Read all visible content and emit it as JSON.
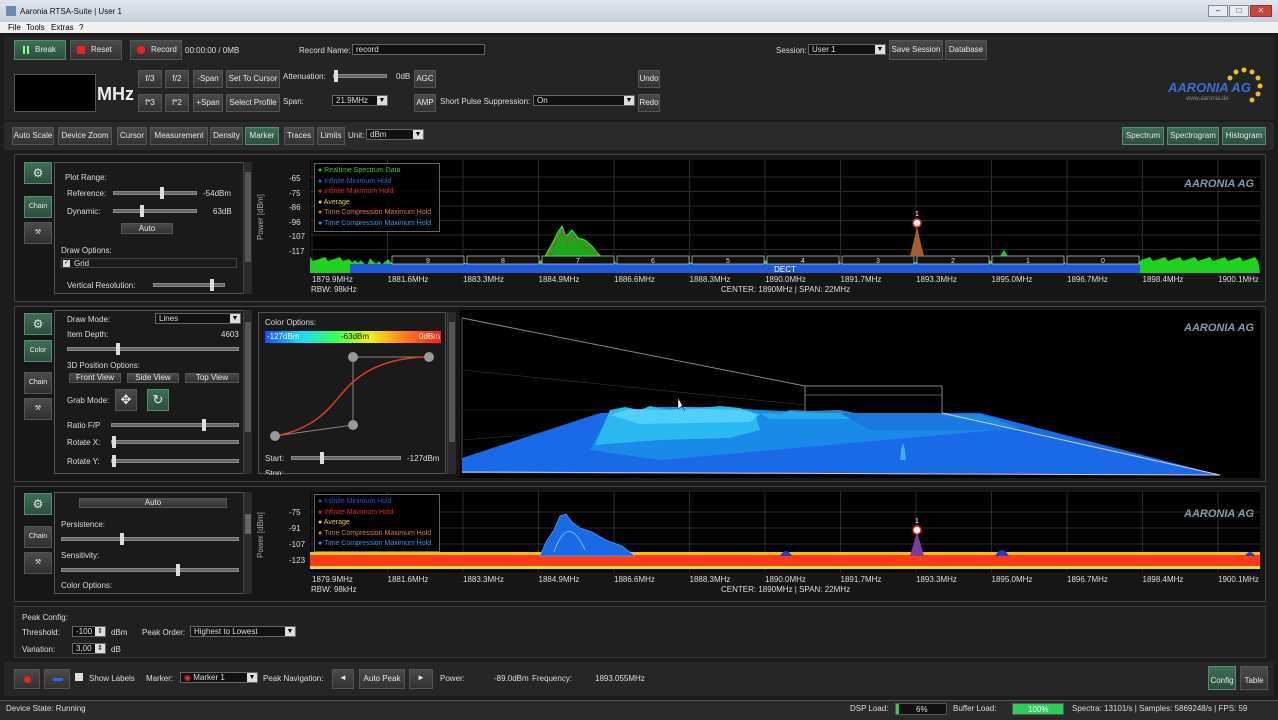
{
  "window": {
    "title": "Aaronia RTSA-Suite | User 1"
  },
  "menu": [
    "File",
    "Tools",
    "Extras",
    "?"
  ],
  "toolbar": {
    "break": "Break",
    "reset": "Reset",
    "record": "Record",
    "record_time": "00:00:00 / 0MB",
    "record_name_label": "Record Name:",
    "record_name_value": "record",
    "session_label": "Session:",
    "session_value": "User 1",
    "save_session": "Save Session",
    "database": "Database",
    "freq_unit": "MHz",
    "f3": "f/3",
    "f2": "f/2",
    "minus_span": "-Span",
    "set_to_cursor": "Set To Cursor",
    "fx3": "f*3",
    "fx2": "f*2",
    "plus_span": "+Span",
    "select_profile": "Select Profile",
    "attenuation_label": "Attenuation:",
    "attenuation_value": "0dB",
    "agc": "AGC",
    "span_label": "Span:",
    "span_value": "21.9MHz",
    "amp": "AMP",
    "sps_label": "Short Pulse Suppression:",
    "sps_value": "On",
    "undo": "Undo",
    "redo": "Redo",
    "logo": "AARONIA AG",
    "logo_sub": "www.aaronia.de"
  },
  "toolbar2": {
    "items": [
      "Auto Scale",
      "Device Zoom",
      "Cursor",
      "Measurement",
      "Density",
      "Marker",
      "Traces",
      "Limits"
    ],
    "unit_label": "Unit:",
    "unit_value": "dBm",
    "views": [
      "Spectrum",
      "Spectrogram",
      "Histogram"
    ]
  },
  "panel1": {
    "side": [
      "Chain"
    ],
    "plot_range": "Plot Range:",
    "reference_label": "Reference:",
    "reference_value": "-54dBm",
    "dynamic_label": "Dynamic:",
    "dynamic_value": "63dB",
    "auto": "Auto",
    "draw_options": "Draw Options:",
    "grid": "Grid",
    "vres": "Vertical Resolution:",
    "ylabel": "Power [dBm]",
    "yticks": [
      "-65",
      "-75",
      "-86",
      "-96",
      "-107",
      "-117"
    ],
    "legend": [
      "Realtime Spectrum Data",
      "Infinite Minimum Hold",
      "Infinite Maximum Hold",
      "Average",
      "Time Compression Maximum Hold",
      "Time Compression Maximum Hold"
    ],
    "channels": [
      "9",
      "8",
      "7",
      "6",
      "5",
      "4",
      "3",
      "2",
      "1",
      "0"
    ],
    "dect": "DECT",
    "xticks": [
      "1879.9MHz",
      "1881.6MHz",
      "1883.3MHz",
      "1884.9MHz",
      "1886.6MHz",
      "1888.3MHz",
      "1890.0MHz",
      "1891.7MHz",
      "1893.3MHz",
      "1895.0MHz",
      "1896.7MHz",
      "1898.4MHz",
      "1900.1MHz"
    ],
    "rbw": "RBW: 98kHz",
    "center": "CENTER: 1890MHz |  SPAN: 22MHz",
    "marker": "1"
  },
  "panel2": {
    "side": [
      "Color",
      "Chain"
    ],
    "draw_mode_label": "Draw Mode:",
    "draw_mode_value": "Lines",
    "item_depth_label": "Item Depth:",
    "item_depth_value": "4603",
    "pos_label": "3D Position Options:",
    "front": "Front View",
    "side_view": "Side View",
    "top": "Top View",
    "grab_label": "Grab Mode:",
    "ratio_label": "Ratio F/P",
    "rotx": "Rotate X:",
    "roty": "Rotate Y:",
    "color_options": "Color Options:",
    "c_low": "-127dBm",
    "c_mid": "-63dBm",
    "c_high": "0dBm",
    "start_label": "Start:",
    "start_value": "-127dBm",
    "stop_label": "Stop:",
    "stop_value": "0dBm"
  },
  "panel3": {
    "side": [
      "Chain"
    ],
    "auto": "Auto",
    "persistence": "Persistence:",
    "sensitivity": "Sensitivity:",
    "color_options": "Color Options:",
    "ylabel": "Power [dBm]",
    "yticks": [
      "-75",
      "-91",
      "-107",
      "-123"
    ],
    "legend": [
      "Infinite Minimum Hold",
      "Infinite Maximum Hold",
      "Average",
      "Time Compression Maximum Hold",
      "Time Compression Maximum Hold"
    ],
    "marker": "1"
  },
  "peak": {
    "title": "Peak Config:",
    "threshold_label": "Threshold:",
    "threshold_value": "-100",
    "threshold_unit": "dBm",
    "order_label": "Peak Order:",
    "order_value": "Highest to Lowest",
    "variation_label": "Variation:",
    "variation_value": "3,00",
    "variation_unit": "dB"
  },
  "bottom": {
    "show_labels": "Show Labels",
    "marker_label": "Marker:",
    "marker_value": "Marker 1",
    "peak_nav": "Peak Navigation:",
    "auto_peak": "Auto Peak",
    "power_label": "Power:",
    "power_value": "-89.0dBm",
    "freq_label": "Frequency:",
    "freq_value": "1893.055MHz",
    "config": "Config",
    "table": "Table"
  },
  "status": {
    "device_state": "Device State: Running",
    "dsp_label": "DSP Load:",
    "dsp_value": "6%",
    "dsp_fraction": 0.06,
    "buffer_label": "Buffer Load:",
    "buffer_value": "100%",
    "buffer_fraction": 1.0,
    "spectra": "Spectra: 13101/s | Samples: 5869248/s | FPS: 59"
  },
  "colors": {
    "accent": "#3e6e56",
    "trace_green": "#22cc22",
    "trace_blue": "#1e7fff",
    "trace_red": "#ff3a1a"
  }
}
